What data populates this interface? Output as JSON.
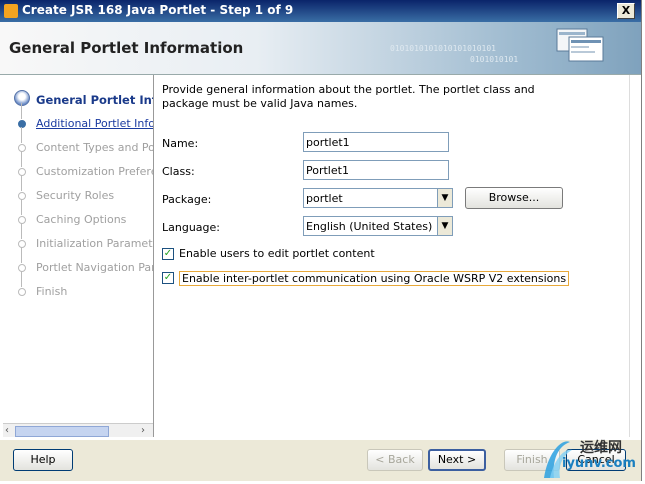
{
  "window": {
    "title": "Create JSR 168 Java Portlet - Step 1 of 9",
    "close_label": "X"
  },
  "header": {
    "title": "General Portlet Information",
    "binary_line1": "0101010101010101010101",
    "binary_line2": "0101010101"
  },
  "steps": [
    {
      "label": "General Portlet Information",
      "state": "current"
    },
    {
      "label": "Additional Portlet Information",
      "state": "next"
    },
    {
      "label": "Content Types and Portlet Modes",
      "state": "disabled"
    },
    {
      "label": "Customization Preferences",
      "state": "disabled"
    },
    {
      "label": "Security Roles",
      "state": "disabled"
    },
    {
      "label": "Caching Options",
      "state": "disabled"
    },
    {
      "label": "Initialization Parameters",
      "state": "disabled"
    },
    {
      "label": "Portlet Navigation Parameters",
      "state": "disabled"
    },
    {
      "label": "Finish",
      "state": "disabled"
    }
  ],
  "form": {
    "intro": "Provide general information about the portlet. The portlet class and package must be valid Java names.",
    "name_label": "Name:",
    "name_value": "portlet1",
    "class_label": "Class:",
    "class_value": "Portlet1",
    "package_label": "Package:",
    "package_value": "portlet",
    "browse_label": "Browse...",
    "language_label": "Language:",
    "language_value": "English (United States)",
    "edit_checkbox_label": "Enable users to edit portlet content",
    "edit_checked": true,
    "ipc_checkbox_label": "Enable inter-portlet communication using Oracle WSRP V2 extensions",
    "ipc_checked": true
  },
  "footer": {
    "help": "Help",
    "back": "< Back",
    "next": "Next >",
    "finish": "Finish",
    "cancel": "Cancel"
  },
  "watermark": {
    "line1": "运维网",
    "line2": "iyunv.com"
  },
  "colors": {
    "titlebar": "#0a246a",
    "current_step": "#1a3a8a",
    "focus": "#e8a93a"
  }
}
